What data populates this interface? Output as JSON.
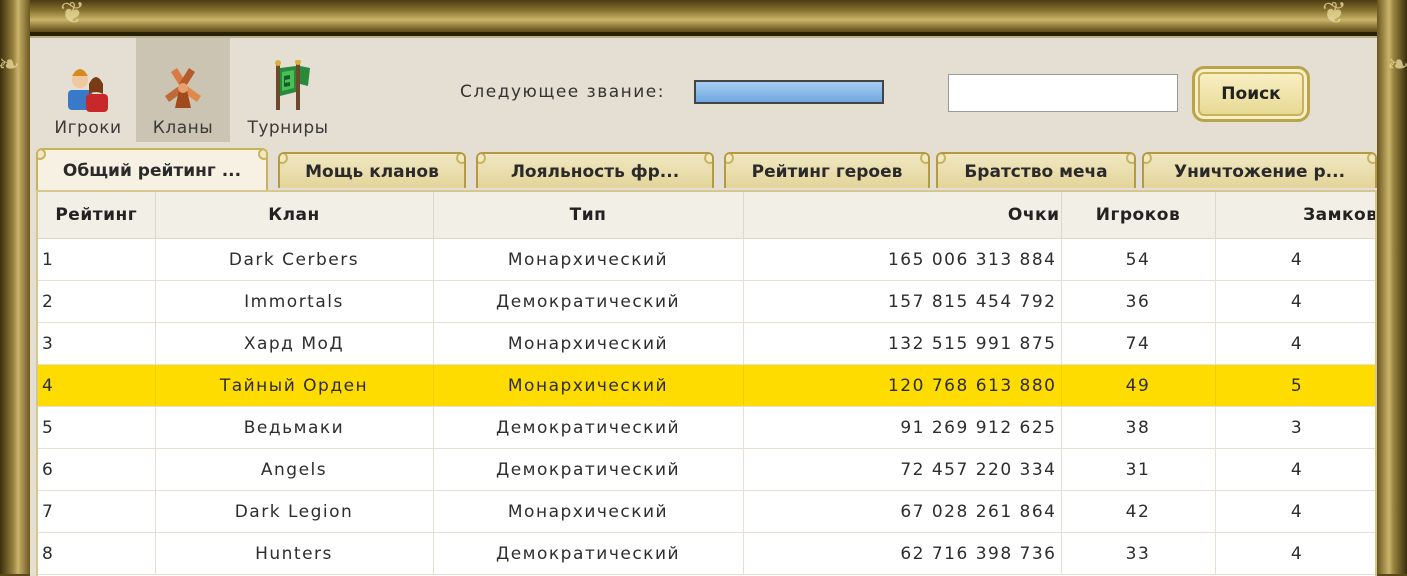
{
  "nav": {
    "items": [
      {
        "label": "Игроки",
        "icon": "players-icon",
        "active": false
      },
      {
        "label": "Кланы",
        "icon": "clans-icon",
        "active": true
      },
      {
        "label": "Турниры",
        "icon": "tournaments-icon",
        "active": false
      }
    ]
  },
  "rank": {
    "label": "Следующее звание:"
  },
  "search": {
    "value": "",
    "placeholder": "",
    "button_label": "Поиск"
  },
  "tabs": [
    {
      "label": "Общий рейтинг ...",
      "active": true
    },
    {
      "label": "Мощь кланов",
      "active": false
    },
    {
      "label": "Лояльность фр...",
      "active": false
    },
    {
      "label": "Рейтинг героев",
      "active": false
    },
    {
      "label": "Братство меча",
      "active": false
    },
    {
      "label": "Уничтожение р...",
      "active": false
    }
  ],
  "table": {
    "headers": {
      "rank": "Рейтинг",
      "clan": "Клан",
      "type": "Тип",
      "points": "Очки",
      "players": "Игроков",
      "castles": "Замков"
    },
    "rows": [
      {
        "rank": "1",
        "clan": "Dark Cerbers",
        "type": "Монархический",
        "points": "165 006 313 884",
        "players": "54",
        "castles": "4",
        "highlight": false
      },
      {
        "rank": "2",
        "clan": "Immortals",
        "type": "Демократический",
        "points": "157 815 454 792",
        "players": "36",
        "castles": "4",
        "highlight": false
      },
      {
        "rank": "3",
        "clan": "Хард МоД",
        "type": "Монархический",
        "points": "132 515 991 875",
        "players": "74",
        "castles": "4",
        "highlight": false
      },
      {
        "rank": "4",
        "clan": "Тайный Орден",
        "type": "Монархический",
        "points": "120 768 613 880",
        "players": "49",
        "castles": "5",
        "highlight": true
      },
      {
        "rank": "5",
        "clan": "Ведьмаки",
        "type": "Демократический",
        "points": "91 269 912 625",
        "players": "38",
        "castles": "3",
        "highlight": false
      },
      {
        "rank": "6",
        "clan": "Angels",
        "type": "Демократический",
        "points": "72 457 220 334",
        "players": "31",
        "castles": "4",
        "highlight": false
      },
      {
        "rank": "7",
        "clan": "Dark Legion",
        "type": "Монархический",
        "points": "67 028 261 864",
        "players": "42",
        "castles": "4",
        "highlight": false
      },
      {
        "rank": "8",
        "clan": "Hunters",
        "type": "Демократический",
        "points": "62 716 398 736",
        "players": "33",
        "castles": "4",
        "highlight": false
      }
    ]
  },
  "colors": {
    "highlight_row": "#fedc00",
    "panel_bg": "#e4dfd2",
    "rank_bar": "#6ea8e0"
  }
}
